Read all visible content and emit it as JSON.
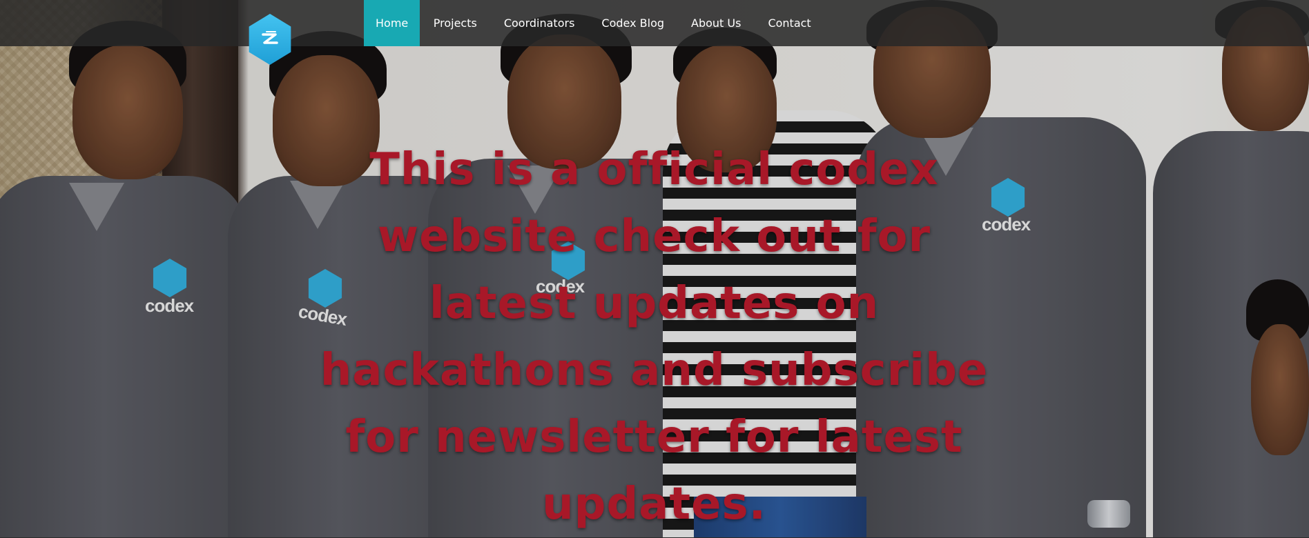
{
  "nav": {
    "logo_icon": "codex-hexagon-logo-icon",
    "items": [
      {
        "label": "Home",
        "active": true
      },
      {
        "label": "Projects",
        "active": false
      },
      {
        "label": "Coordinators",
        "active": false
      },
      {
        "label": "Codex Blog",
        "active": false
      },
      {
        "label": "About Us",
        "active": false
      },
      {
        "label": "Contact",
        "active": false
      }
    ],
    "colors": {
      "bar": "#282828",
      "active": "#18a9b3",
      "text": "#ffffff"
    }
  },
  "hero": {
    "heading": "This is a official codex website check out for latest updates on hackathons and subscribe for newsletter for latest updates.",
    "heading_color": "#a81828",
    "background": "team-photo",
    "shirt_print": [
      "codex",
      "codex",
      "codex",
      "codex"
    ]
  }
}
